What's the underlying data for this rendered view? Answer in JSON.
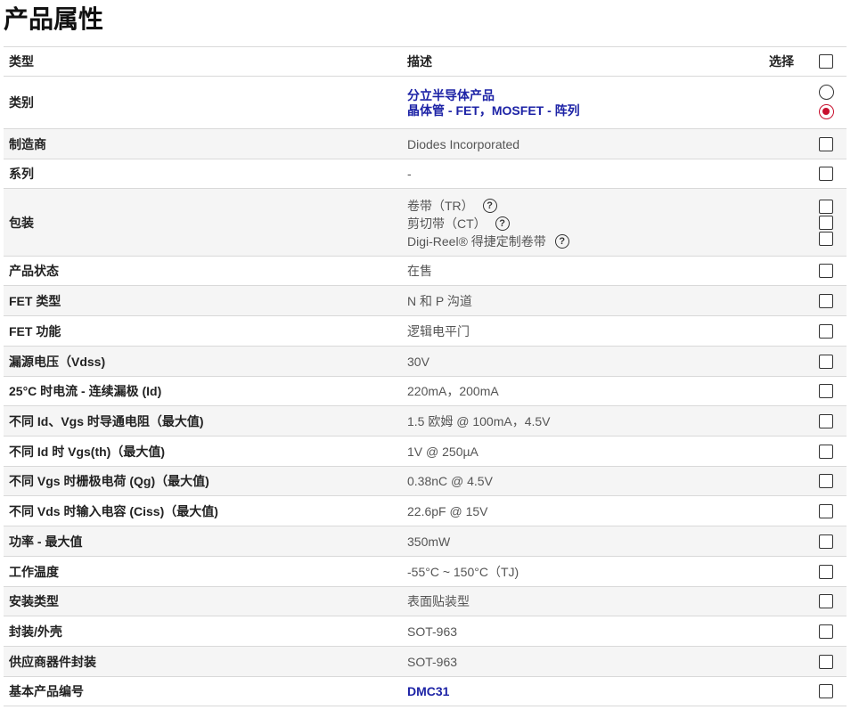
{
  "page": {
    "title": "产品属性"
  },
  "header": {
    "type": "类型",
    "desc": "描述",
    "select": "选择"
  },
  "category": {
    "type": "类别",
    "lines": [
      "分立半导体产品",
      "晶体管 - FET，MOSFET - 阵列"
    ]
  },
  "packaging": {
    "type": "包装",
    "options": [
      "卷带（TR）",
      "剪切带（CT）",
      "Digi-Reel® 得捷定制卷带"
    ],
    "help": "?"
  },
  "rows": [
    {
      "type": "制造商",
      "desc": "Diodes Incorporated"
    },
    {
      "type": "系列",
      "desc": "-"
    },
    {
      "type": "产品状态",
      "desc": "在售"
    },
    {
      "type": "FET 类型",
      "desc": "N 和 P 沟道"
    },
    {
      "type": "FET 功能",
      "desc": "逻辑电平门"
    },
    {
      "type": "漏源电压（Vdss)",
      "desc": "30V"
    },
    {
      "type": "25°C 时电流 - 连续漏极 (Id)",
      "desc": "220mA，200mA"
    },
    {
      "type": "不同 Id、Vgs 时导通电阻（最大值)",
      "desc": "1.5 欧姆 @ 100mA，4.5V"
    },
    {
      "type": "不同 Id 时 Vgs(th)（最大值)",
      "desc": "1V @ 250µA"
    },
    {
      "type": "不同 Vgs 时栅极电荷 (Qg)（最大值)",
      "desc": "0.38nC @ 4.5V"
    },
    {
      "type": "不同 Vds 时输入电容 (Ciss)（最大值)",
      "desc": "22.6pF @ 15V"
    },
    {
      "type": "功率 - 最大值",
      "desc": "350mW"
    },
    {
      "type": "工作温度",
      "desc": "-55°C ~ 150°C（TJ)"
    },
    {
      "type": "安装类型",
      "desc": "表面贴装型"
    },
    {
      "type": "封装/外壳",
      "desc": "SOT-963"
    },
    {
      "type": "供应商器件封装",
      "desc": "SOT-963"
    },
    {
      "type": "基本产品编号",
      "desc": "DMC31"
    }
  ]
}
